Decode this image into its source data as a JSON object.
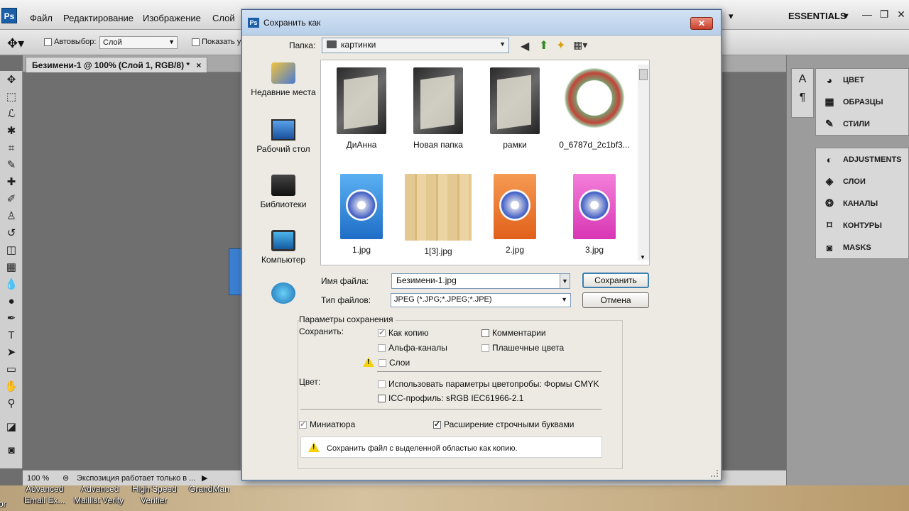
{
  "photoshop": {
    "menu": [
      "Файл",
      "Редактирование",
      "Изображение",
      "Слой"
    ],
    "workspace": "ESSENTIALS",
    "options": {
      "autoselect_label": "Автовыбор:",
      "autoselect_value": "Слой",
      "show_label": "Показать у"
    },
    "doc_tab": "Безимени-1 @ 100% (Слой 1, RGB/8) *",
    "doc_tab_close": "×",
    "status": {
      "zoom": "100 %",
      "message": "Экспозиция работает только в ..."
    },
    "panels_top": [
      "ЦВЕТ",
      "ОБРАЗЦЫ",
      "СТИЛИ"
    ],
    "panels_bottom": [
      "ADJUSTMENTS",
      "СЛОИ",
      "КАНАЛЫ",
      "КОНТУРЫ",
      "MASKS"
    ]
  },
  "desktop_labels": [
    "Advanced",
    "Advanced",
    "High Speed",
    "GrandMan",
    "Email Ex...",
    "Maillist Verify",
    "Verifier",
    "or"
  ],
  "dialog": {
    "title": "Сохранить как",
    "folder_label": "Папка:",
    "folder_value": "картинки",
    "places": [
      "Недавние места",
      "Рабочий стол",
      "Библиотеки",
      "Компьютер"
    ],
    "files": [
      {
        "name": "ДиАнна",
        "kind": "folder"
      },
      {
        "name": "Новая папка",
        "kind": "folder"
      },
      {
        "name": "рамки",
        "kind": "folder"
      },
      {
        "name": "0_6787d_2c1bf3...",
        "kind": "image"
      },
      {
        "name": "1.jpg",
        "kind": "image",
        "color": "#2f86e0"
      },
      {
        "name": "1[3].jpg",
        "kind": "image"
      },
      {
        "name": "2.jpg",
        "kind": "image",
        "color": "#f07a2a"
      },
      {
        "name": "3.jpg",
        "kind": "image",
        "color": "#e64cc4"
      }
    ],
    "filename_label": "Имя файла:",
    "filename_value": "Безимени-1.jpg",
    "filetype_label": "Тип файлов:",
    "filetype_value": "JPEG (*.JPG;*.JPEG;*.JPE)",
    "save_button": "Сохранить",
    "cancel_button": "Отмена",
    "options_title": "Параметры сохранения",
    "save_label": "Сохранить:",
    "as_copy": "Как копию",
    "comments": "Комментарии",
    "alpha": "Альфа-каналы",
    "spot": "Плашечные цвета",
    "layers": "Слои",
    "color_label": "Цвет:",
    "proof": "Использовать параметры цветопробы:  Формы CMYK",
    "icc": "ICC-профиль:  sRGB IEC61966-2.1",
    "thumbnail": "Миниатюра",
    "lowercase": "Расширение строчными буквами",
    "warning": "Сохранить файл с выделенной областью как копию."
  }
}
